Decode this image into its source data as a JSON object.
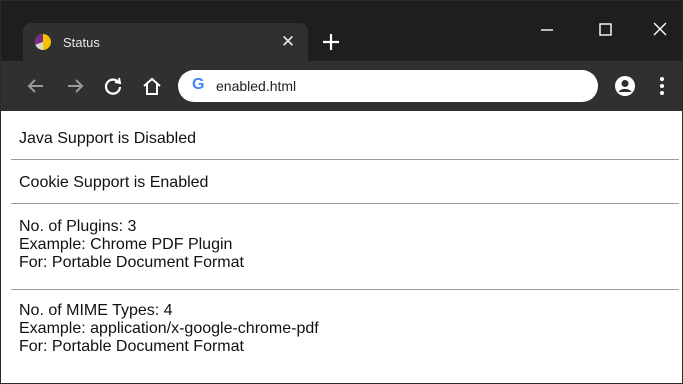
{
  "browser": {
    "tab": {
      "title": "Status"
    },
    "address_bar": {
      "url": "enabled.html"
    }
  },
  "page": {
    "java": "Java Support is Disabled",
    "cookie": "Cookie Support is Enabled",
    "plugins": {
      "count": "No. of Plugins: 3",
      "example": "Example: Chrome PDF Plugin",
      "for": "For: Portable Document Format"
    },
    "mime": {
      "count": "No. of MIME Types: 4",
      "example": "Example: application/x-google-chrome-pdf",
      "for": "For: Portable Document Format"
    }
  }
}
